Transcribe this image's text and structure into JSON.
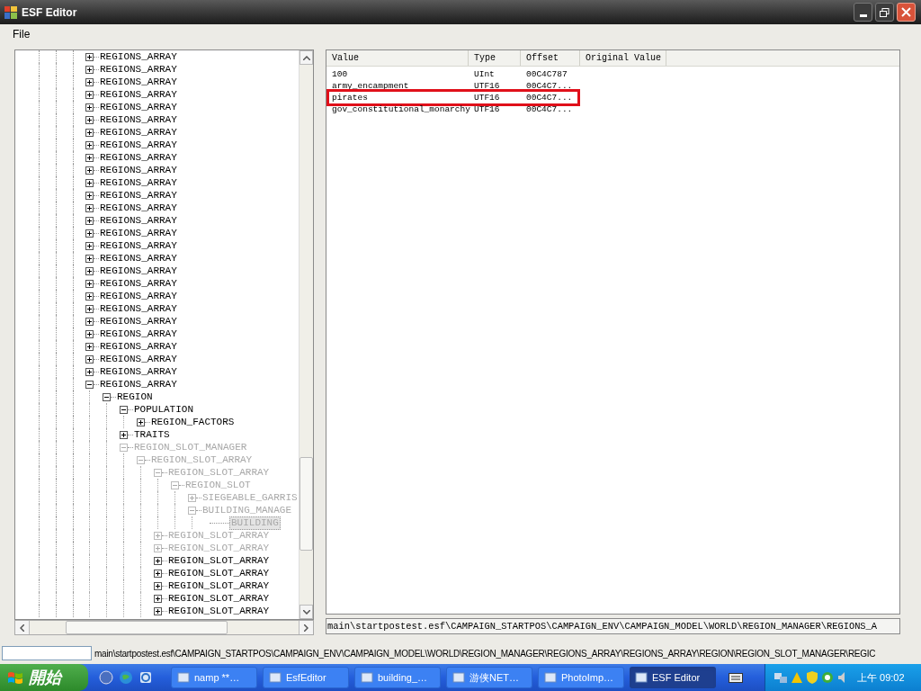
{
  "window": {
    "title": "ESF Editor"
  },
  "menu": [
    {
      "label": "File"
    }
  ],
  "tree": [
    {
      "label": "REGIONS_ARRAY",
      "expanded": false,
      "dimmed": false,
      "selected": false
    },
    {
      "label": "REGIONS_ARRAY",
      "expanded": false,
      "dimmed": false,
      "selected": false
    },
    {
      "label": "REGIONS_ARRAY",
      "expanded": false,
      "dimmed": false,
      "selected": false
    },
    {
      "label": "REGIONS_ARRAY",
      "expanded": false,
      "dimmed": false,
      "selected": false
    },
    {
      "label": "REGIONS_ARRAY",
      "expanded": false,
      "dimmed": false,
      "selected": false
    },
    {
      "label": "REGIONS_ARRAY",
      "expanded": false,
      "dimmed": false,
      "selected": false
    },
    {
      "label": "REGIONS_ARRAY",
      "expanded": false,
      "dimmed": false,
      "selected": false
    },
    {
      "label": "REGIONS_ARRAY",
      "expanded": false,
      "dimmed": false,
      "selected": false
    },
    {
      "label": "REGIONS_ARRAY",
      "expanded": false,
      "dimmed": false,
      "selected": false
    },
    {
      "label": "REGIONS_ARRAY",
      "expanded": false,
      "dimmed": false,
      "selected": false
    },
    {
      "label": "REGIONS_ARRAY",
      "expanded": false,
      "dimmed": false,
      "selected": false
    },
    {
      "label": "REGIONS_ARRAY",
      "expanded": false,
      "dimmed": false,
      "selected": false
    },
    {
      "label": "REGIONS_ARRAY",
      "expanded": false,
      "dimmed": false,
      "selected": false
    },
    {
      "label": "REGIONS_ARRAY",
      "expanded": false,
      "dimmed": false,
      "selected": false
    },
    {
      "label": "REGIONS_ARRAY",
      "expanded": false,
      "dimmed": false,
      "selected": false
    },
    {
      "label": "REGIONS_ARRAY",
      "expanded": false,
      "dimmed": false,
      "selected": false
    },
    {
      "label": "REGIONS_ARRAY",
      "expanded": false,
      "dimmed": false,
      "selected": false
    },
    {
      "label": "REGIONS_ARRAY",
      "expanded": false,
      "dimmed": false,
      "selected": false
    },
    {
      "label": "REGIONS_ARRAY",
      "expanded": false,
      "dimmed": false,
      "selected": false
    },
    {
      "label": "REGIONS_ARRAY",
      "expanded": false,
      "dimmed": false,
      "selected": false
    },
    {
      "label": "REGIONS_ARRAY",
      "expanded": false,
      "dimmed": false,
      "selected": false
    },
    {
      "label": "REGIONS_ARRAY",
      "expanded": false,
      "dimmed": false,
      "selected": false
    },
    {
      "label": "REGIONS_ARRAY",
      "expanded": false,
      "dimmed": false,
      "selected": false
    },
    {
      "label": "REGIONS_ARRAY",
      "expanded": false,
      "dimmed": false,
      "selected": false
    },
    {
      "label": "REGIONS_ARRAY",
      "expanded": false,
      "dimmed": false,
      "selected": false
    },
    {
      "label": "REGIONS_ARRAY",
      "expanded": false,
      "dimmed": false,
      "selected": false
    },
    {
      "label": "REGIONS_ARRAY",
      "expanded": true,
      "dimmed": false,
      "selected": false,
      "children": [
        {
          "label": "REGION",
          "expanded": true,
          "dimmed": false,
          "selected": false,
          "children": [
            {
              "label": "POPULATION",
              "expanded": true,
              "dimmed": false,
              "selected": false,
              "children": [
                {
                  "label": "REGION_FACTORS",
                  "expanded": false,
                  "dimmed": false,
                  "selected": false
                }
              ]
            },
            {
              "label": "TRAITS",
              "expanded": false,
              "dimmed": false,
              "selected": false
            },
            {
              "label": "REGION_SLOT_MANAGER",
              "expanded": true,
              "dimmed": true,
              "selected": false,
              "children": [
                {
                  "label": "REGION_SLOT_ARRAY",
                  "expanded": true,
                  "dimmed": true,
                  "selected": false,
                  "children": [
                    {
                      "label": "REGION_SLOT_ARRAY",
                      "expanded": true,
                      "dimmed": true,
                      "selected": false,
                      "children": [
                        {
                          "label": "REGION_SLOT",
                          "expanded": true,
                          "dimmed": true,
                          "selected": false,
                          "children": [
                            {
                              "label": "SIEGEABLE_GARRIS",
                              "expanded": false,
                              "dimmed": true,
                              "selected": false
                            },
                            {
                              "label": "BUILDING_MANAGE",
                              "expanded": true,
                              "dimmed": true,
                              "selected": false,
                              "children": [
                                {
                                  "label": "BUILDING",
                                  "dimmed": true,
                                  "selected": true
                                }
                              ]
                            }
                          ]
                        }
                      ]
                    },
                    {
                      "label": "REGION_SLOT_ARRAY",
                      "expanded": false,
                      "dimmed": true,
                      "selected": false
                    },
                    {
                      "label": "REGION_SLOT_ARRAY",
                      "expanded": false,
                      "dimmed": true,
                      "selected": false
                    },
                    {
                      "label": "REGION_SLOT_ARRAY",
                      "expanded": false,
                      "dimmed": false,
                      "selected": false
                    },
                    {
                      "label": "REGION_SLOT_ARRAY",
                      "expanded": false,
                      "dimmed": false,
                      "selected": false
                    },
                    {
                      "label": "REGION_SLOT_ARRAY",
                      "expanded": false,
                      "dimmed": false,
                      "selected": false
                    },
                    {
                      "label": "REGION_SLOT_ARRAY",
                      "expanded": false,
                      "dimmed": false,
                      "selected": false
                    },
                    {
                      "label": "REGION_SLOT_ARRAY",
                      "expanded": false,
                      "dimmed": false,
                      "selected": false
                    }
                  ]
                }
              ]
            }
          ]
        }
      ]
    }
  ],
  "list": {
    "columns": [
      "Value",
      "Type",
      "Offset",
      "Original Value"
    ],
    "rows": [
      {
        "cells": [
          "100",
          "UInt",
          "00C4C787"
        ],
        "marked": false
      },
      {
        "cells": [
          "army_encampment",
          "UTF16",
          "00C4C7..."
        ],
        "marked": false
      },
      {
        "cells": [
          "pirates",
          "UTF16",
          "00C4C7..."
        ],
        "marked": true
      },
      {
        "cells": [
          "gov_constitutional_monarchy",
          "UTF16",
          "00C4C7..."
        ],
        "marked": false
      }
    ]
  },
  "path_field": {
    "value": "main\\startpostest.esf\\CAMPAIGN_STARTPOS\\CAMPAIGN_ENV\\CAMPAIGN_MODEL\\WORLD\\REGION_MANAGER\\REGIONS_A"
  },
  "status_bar": {
    "path": "main\\startpostest.esf\\CAMPAIGN_STARTPOS\\CAMPAIGN_ENV\\CAMPAIGN_MODEL\\WORLD\\REGION_MANAGER\\REGIONS_ARRAY\\REGIONS_ARRAY\\REGION\\REGION_SLOT_MANAGER\\REGIC"
  },
  "taskbar": {
    "start": "開始",
    "tasks": [
      {
        "label": "namp **…",
        "selected": false
      },
      {
        "label": "EsfEditor",
        "selected": false
      },
      {
        "label": "building_…",
        "selected": false
      },
      {
        "label": "游侠NET…",
        "selected": false
      },
      {
        "label": "PhotoImp…",
        "selected": false
      },
      {
        "label": "ESF Editor",
        "selected": true
      }
    ],
    "clock": "上午 09:02"
  }
}
